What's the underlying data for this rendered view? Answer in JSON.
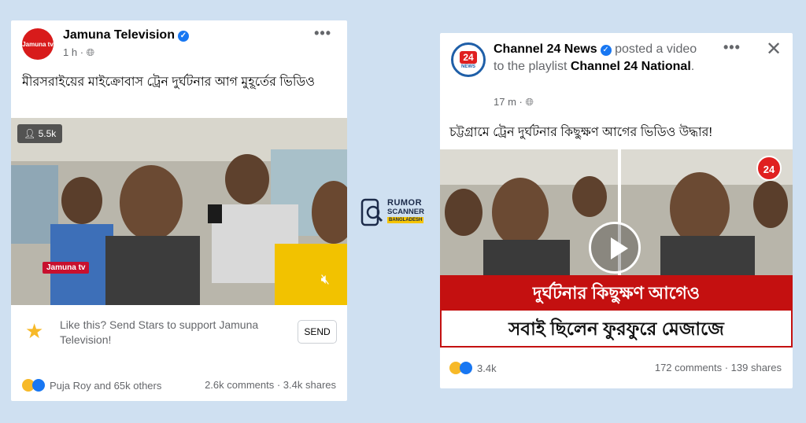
{
  "left_post": {
    "page_name": "Jamuna Television",
    "avatar_text": "Jamuna tv",
    "time": "1 h",
    "caption": "মীরসরাইয়ের মাইক্রোবাস ট্রেন দুর্ঘটনার আগ মুহূর্তের ভিডিও",
    "view_count": "5.5k",
    "watermark": "Jamuna tv",
    "stars_prompt": "Like this? Send Stars to support Jamuna Television!",
    "send_label": "SEND",
    "reactions_text": "Puja Roy and 65k others",
    "comments": "2.6k comments",
    "shares": "3.4k shares"
  },
  "center_logo": {
    "line1": "RUMOR",
    "line2": "SCANNER",
    "line3": "BANGLADESH"
  },
  "right_post": {
    "page_name": "Channel 24 News",
    "action_text": "posted a video to the playlist",
    "playlist": "Channel 24 National",
    "time": "17 m",
    "avatar_text": "24",
    "avatar_sub": "NEWS",
    "caption": "চট্টগ্রামে ট্রেন দুর্ঘটনার কিছুক্ষণ আগের ভিডিও উদ্ধার!",
    "watermark": "24",
    "banner_top": "দুর্ঘটনার কিছুক্ষণ আগেও",
    "banner_bottom": "সবাই ছিলেন ফুরফুরে মেজাজে",
    "reactions_count": "3.4k",
    "comments": "172 comments",
    "shares": "139 shares"
  }
}
